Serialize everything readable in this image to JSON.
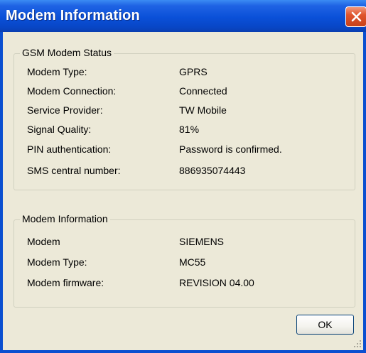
{
  "window": {
    "title": "Modem Information"
  },
  "gsm_status": {
    "legend": "GSM Modem Status",
    "rows": [
      {
        "label": "Modem Type:",
        "value": "GPRS"
      },
      {
        "label": "Modem Connection:",
        "value": "Connected"
      },
      {
        "label": "Service Provider:",
        "value": "TW Mobile"
      },
      {
        "label": "Signal Quality:",
        "value": "81%"
      },
      {
        "label": "PIN authentication:",
        "value": "Password is confirmed."
      },
      {
        "label": "SMS central number:",
        "value": "886935074443"
      }
    ]
  },
  "modem_info": {
    "legend": "Modem Information",
    "rows": [
      {
        "label": "Modem",
        "value": "SIEMENS"
      },
      {
        "label": "Modem Type:",
        "value": "MC55"
      },
      {
        "label": "Modem firmware:",
        "value": "REVISION 04.00"
      }
    ]
  },
  "buttons": {
    "ok_label": "OK"
  },
  "colors": {
    "title_bar": "#0a50d8",
    "dialog_bg": "#ece9d8",
    "close_button": "#e0552e"
  }
}
